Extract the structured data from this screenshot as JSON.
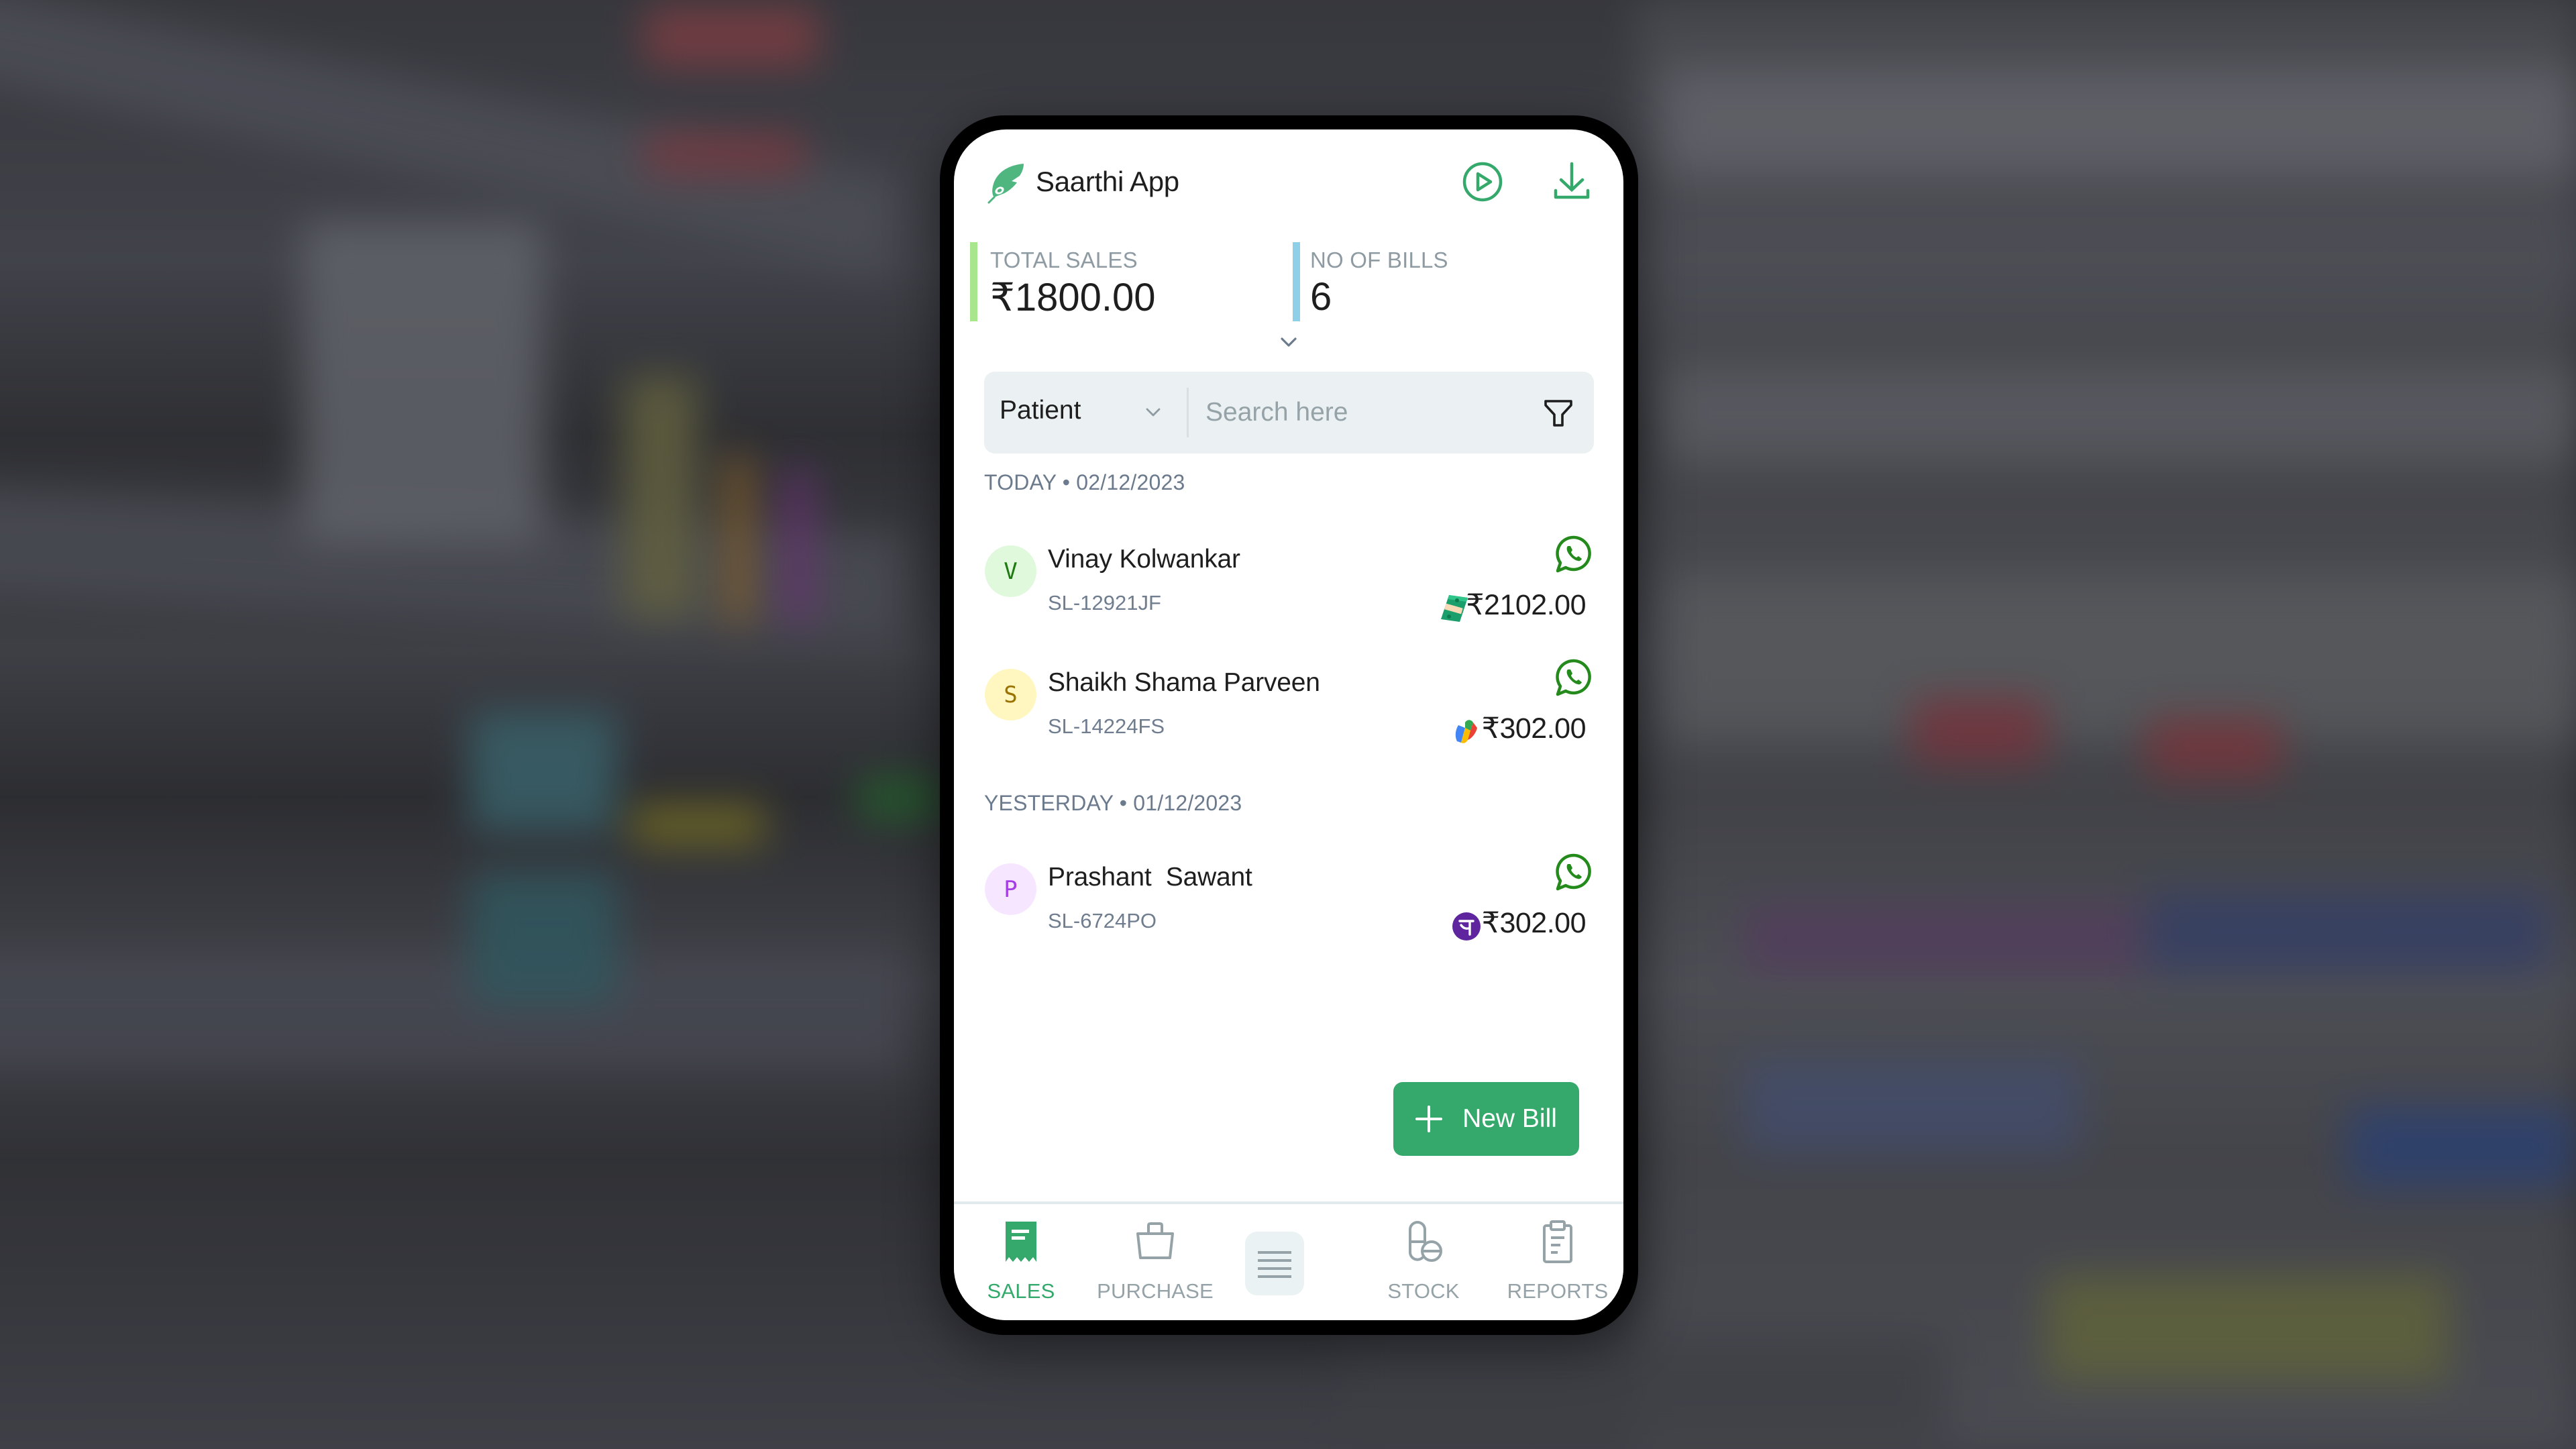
{
  "app": {
    "title": "Saarthi App",
    "icons": {
      "logo": "leaf-logo-icon",
      "play": "play-circle-icon",
      "download": "download-icon"
    }
  },
  "colors": {
    "brand_green": "#35a96b",
    "sales_bar": "#a8e68e",
    "bills_bar": "#8dd0e8",
    "whatsapp_green": "#248a1c",
    "search_bg": "#ebf0f2"
  },
  "stats": {
    "total_sales": {
      "label": "TOTAL SALES",
      "value": "₹1800.00"
    },
    "no_of_bills": {
      "label": "NO OF BILLS",
      "value": "6"
    },
    "expand_icon": "chevron-down-icon"
  },
  "search": {
    "filter_select": {
      "selected": "Patient"
    },
    "placeholder": "Search here",
    "value": "",
    "filter_icon": "funnel-icon"
  },
  "groups": [
    {
      "header": "TODAY • 02/12/2023",
      "bills": [
        {
          "initial": "V",
          "name": "Vinay Kolwankar",
          "bill_id": "SL-12921JF",
          "amount": "₹2102.00",
          "payment_method": "cash",
          "payment_icon": "cash-icon",
          "share_icon": "whatsapp-icon",
          "avatar_bg": "#e0f9dd",
          "avatar_fg": "#1f7a12"
        },
        {
          "initial": "S",
          "name": "Shaikh Shama Parveen",
          "bill_id": "SL-14224FS",
          "amount": "₹302.00",
          "payment_method": "google-pay",
          "payment_icon": "google-pay-icon",
          "share_icon": "whatsapp-icon",
          "avatar_bg": "#fff7bf",
          "avatar_fg": "#9a7200"
        }
      ]
    },
    {
      "header": "YESTERDAY • 01/12/2023",
      "bills": [
        {
          "initial": "P",
          "name": "Prashant  Sawant",
          "bill_id": "SL-6724PO",
          "amount": "₹302.00",
          "payment_method": "phonepe",
          "payment_icon": "phonepe-icon",
          "share_icon": "whatsapp-icon",
          "avatar_bg": "#f7e6ff",
          "avatar_fg": "#a63ee6"
        }
      ]
    }
  ],
  "new_bill_button": {
    "label": "New Bill",
    "icon": "plus-icon"
  },
  "bottom_nav": {
    "items": [
      {
        "label": "SALES",
        "icon": "receipt-icon",
        "active": true
      },
      {
        "label": "PURCHASE",
        "icon": "basket-icon",
        "active": false
      },
      {
        "label": "",
        "icon": "menu-icon",
        "active": false
      },
      {
        "label": "STOCK",
        "icon": "pills-icon",
        "active": false
      },
      {
        "label": "REPORTS",
        "icon": "clipboard-icon",
        "active": false
      }
    ]
  }
}
